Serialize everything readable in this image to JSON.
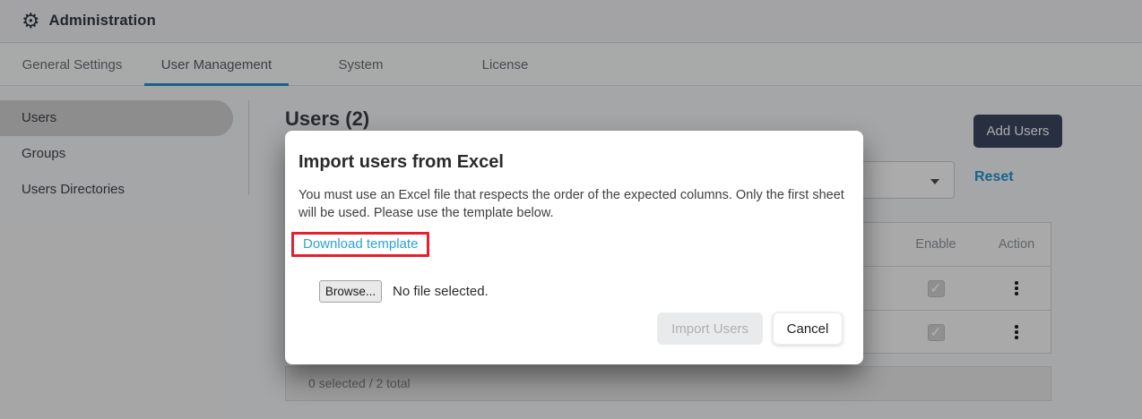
{
  "header": {
    "app_title": "Administration"
  },
  "tabs": {
    "items": [
      {
        "label": "General Settings",
        "active": false
      },
      {
        "label": "User Management",
        "active": true
      },
      {
        "label": "System",
        "active": false
      },
      {
        "label": "License",
        "active": false
      }
    ]
  },
  "sidebar": {
    "items": [
      {
        "label": "Users",
        "selected": true
      },
      {
        "label": "Groups",
        "selected": false
      },
      {
        "label": "Users Directories",
        "selected": false
      }
    ]
  },
  "main": {
    "heading": "Users (2)",
    "add_users_button": "Add Users",
    "reset_link": "Reset",
    "table": {
      "columns": [
        "Enable",
        "Action"
      ],
      "rows": [
        {
          "enable_checked": true
        },
        {
          "enable_checked": true
        }
      ],
      "footer": "0 selected / 2 total"
    }
  },
  "modal": {
    "title": "Import users from Excel",
    "body": "You must use an Excel file that respects the order of the expected columns. Only the first sheet will be used. Please use the template below.",
    "download_template_link": "Download template",
    "file_input": {
      "browse_label": "Browse...",
      "status": "No file selected."
    },
    "import_button": "Import Users",
    "cancel_button": "Cancel"
  },
  "icons": {
    "gear": "gear-icon",
    "chevron": "chevron-down-icon",
    "kebab": "kebab-menu-icon"
  },
  "colors": {
    "accent_blue": "#2196c9",
    "link_blue": "#2aa3da",
    "brand_navy": "#3c4760",
    "highlight_red": "#e5202e"
  }
}
